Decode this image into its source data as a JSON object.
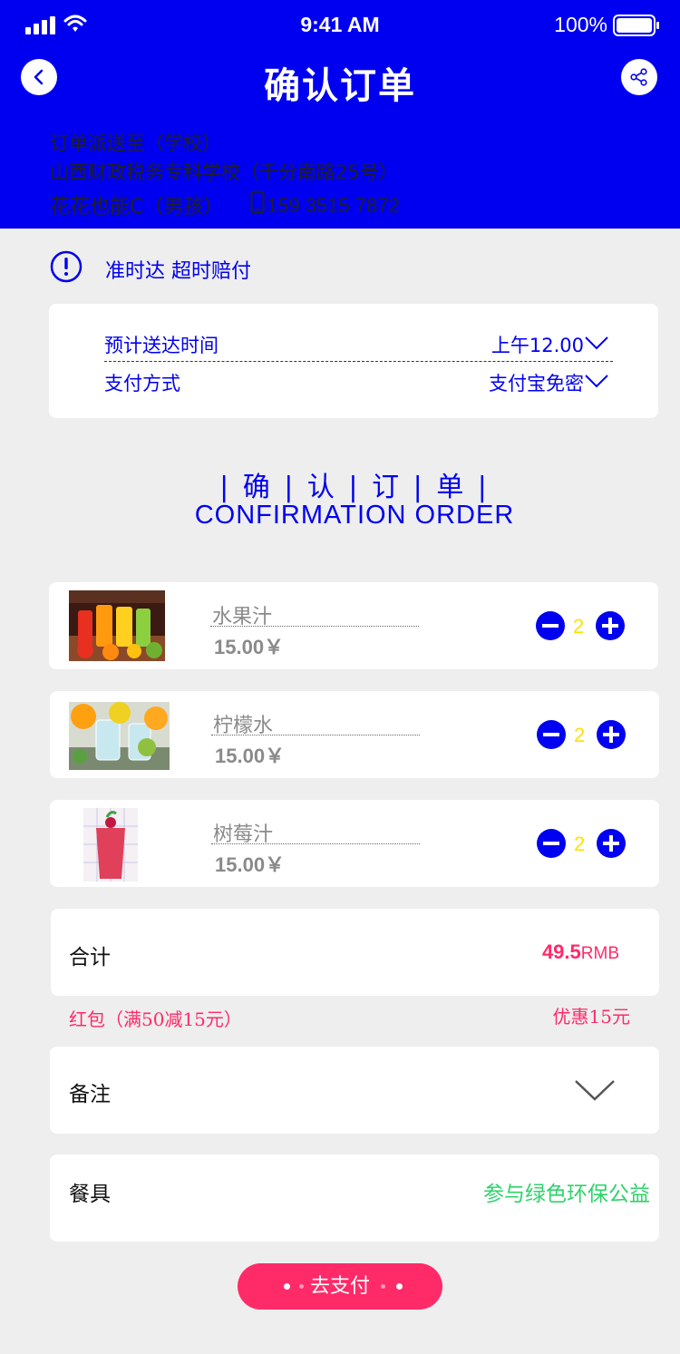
{
  "status_bar": {
    "time": "9:41 AM",
    "battery": "100%"
  },
  "nav": {
    "title": "确认订单"
  },
  "address": {
    "line1": "订单派送至（学校）",
    "line2": "山西财政税务专科学校（千分南路25号）",
    "receiver": "花花也能C（男孩）",
    "phone": "159 3515 7872"
  },
  "promise": {
    "text": "准时达  超时赔付"
  },
  "delivery": {
    "time_label": "预计送达时间",
    "time_value": "上午12.00",
    "pay_label": "支付方式",
    "pay_value": "支付宝免密"
  },
  "section": {
    "title": "| 确 | 认 | 订 | 单 |",
    "subtitle": "CONFIRMATION ORDER"
  },
  "items": [
    {
      "name": "水果汁",
      "price": "15.00￥",
      "qty": "2"
    },
    {
      "name": "柠檬水",
      "price": "15.00￥",
      "qty": "2"
    },
    {
      "name": "树莓汁",
      "price": "15.00￥",
      "qty": "2"
    }
  ],
  "summary": {
    "total_label": "合计",
    "total_value": "49.5",
    "total_unit": "RMB",
    "redpack": "红包（满50减15元）",
    "discount": "优惠15元"
  },
  "note": {
    "label": "备注"
  },
  "utensil": {
    "label": "餐具",
    "value": "参与绿色环保公益"
  },
  "pay_button": {
    "label": "去支付"
  },
  "colors": {
    "primary": "#0000f0",
    "accent": "#ff2a68",
    "green": "#2ed36a",
    "qty": "#ffe100"
  },
  "icons": [
    "signal-icon",
    "wifi-icon",
    "battery-icon",
    "back-icon",
    "share-icon",
    "phone-icon",
    "alert-icon",
    "chevron-down-icon",
    "minus-icon",
    "plus-icon"
  ]
}
